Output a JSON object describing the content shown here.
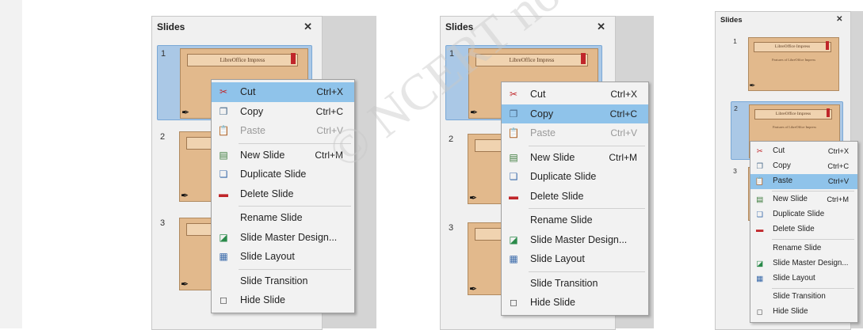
{
  "panel": {
    "title": "Slides",
    "close_symbol": "✕"
  },
  "slide": {
    "title": "LibreOffice Impress",
    "subtitle": "Features of LibreOffice Impress"
  },
  "slide_numbers": [
    "1",
    "2",
    "3"
  ],
  "menu_items": [
    {
      "label": "Cut",
      "shortcut": "Ctrl+X",
      "icon": "scissors-icon"
    },
    {
      "label": "Copy",
      "shortcut": "Ctrl+C",
      "icon": "copy-icon"
    },
    {
      "label": "Paste",
      "shortcut": "Ctrl+V",
      "icon": "paste-icon"
    },
    {
      "label": "New Slide",
      "shortcut": "Ctrl+M",
      "icon": "new-slide-icon"
    },
    {
      "label": "Duplicate Slide",
      "shortcut": "",
      "icon": "duplicate-slide-icon"
    },
    {
      "label": "Delete Slide",
      "shortcut": "",
      "icon": "delete-slide-icon"
    },
    {
      "label": "Rename Slide",
      "shortcut": "",
      "icon": ""
    },
    {
      "label": "Slide Master Design...",
      "shortcut": "",
      "icon": "master-design-icon"
    },
    {
      "label": "Slide Layout",
      "shortcut": "",
      "icon": "layout-icon"
    },
    {
      "label": "Slide Transition",
      "shortcut": "",
      "icon": ""
    },
    {
      "label": "Hide Slide",
      "shortcut": "",
      "icon": "hide-slide-icon"
    }
  ],
  "variants": [
    {
      "highlighted": "Cut",
      "paste_disabled": true
    },
    {
      "highlighted": "Copy",
      "paste_disabled": true
    },
    {
      "highlighted": "Paste",
      "paste_disabled": false
    }
  ],
  "watermark": {
    "text": "© NCERT not to be republished"
  },
  "colors": {
    "highlight": "#8fc3ea",
    "selected_slide": "#aac8e6",
    "slide": "#e2b98c",
    "flag": "#c0262a",
    "disabled_text": "#9a9a9a"
  }
}
